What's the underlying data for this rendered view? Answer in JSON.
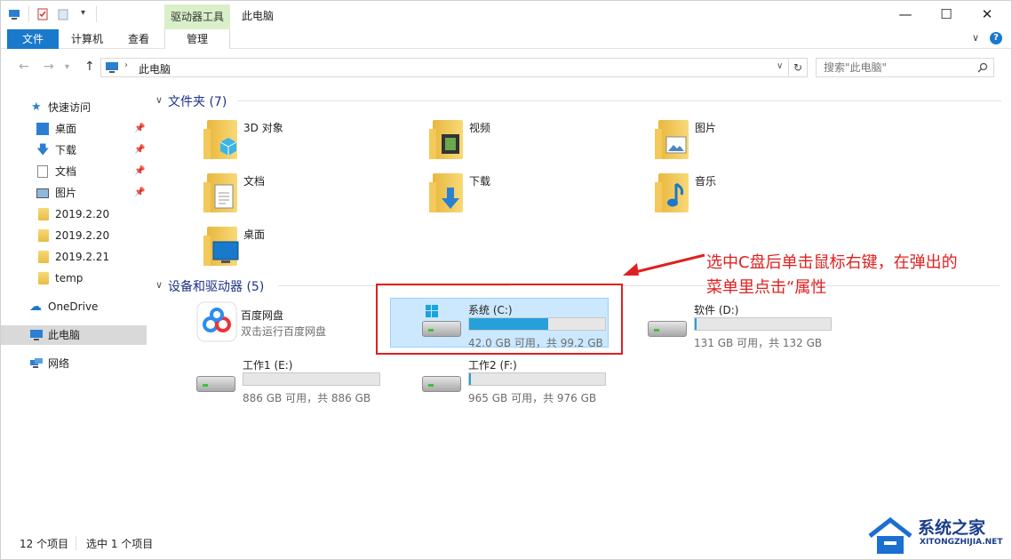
{
  "titlebar": {
    "context_tab": "驱动器工具",
    "window_title": "此电脑",
    "minimize": "—",
    "maximize": "☐",
    "close": "✕"
  },
  "ribbon": {
    "tabs": [
      "文件",
      "计算机",
      "查看",
      "管理"
    ],
    "help": "?",
    "expand": "∨"
  },
  "address": {
    "path": "此电脑",
    "search_placeholder": "搜索\"此电脑\"",
    "back": "←",
    "forward": "→",
    "up": "↑",
    "refresh": "↻",
    "dropdown": "∨"
  },
  "sidebar": {
    "quick_access": "快速访问",
    "items": [
      {
        "label": "桌面",
        "pinned": true
      },
      {
        "label": "下载",
        "pinned": true
      },
      {
        "label": "文档",
        "pinned": true
      },
      {
        "label": "图片",
        "pinned": true
      },
      {
        "label": "2019.2.20",
        "pinned": false
      },
      {
        "label": "2019.2.20",
        "pinned": false
      },
      {
        "label": "2019.2.21",
        "pinned": false
      },
      {
        "label": "temp",
        "pinned": false
      }
    ],
    "onedrive": "OneDrive",
    "this_pc": "此电脑",
    "network": "网络"
  },
  "folders": {
    "header": "文件夹 (7)",
    "items": [
      "3D 对象",
      "视频",
      "图片",
      "文档",
      "下载",
      "音乐",
      "桌面"
    ]
  },
  "drives": {
    "header": "设备和驱动器 (5)",
    "baidu": {
      "name": "百度网盘",
      "sub": "双击运行百度网盘"
    },
    "items": [
      {
        "name": "系统 (C:)",
        "sub": "42.0 GB 可用，共 99.2 GB",
        "used_fraction": 0.58
      },
      {
        "name": "软件 (D:)",
        "sub": "131 GB 可用，共 132 GB",
        "used_fraction": 0.01
      },
      {
        "name": "工作1 (E:)",
        "sub": "886 GB 可用，共 886 GB",
        "used_fraction": 0.0
      },
      {
        "name": "工作2 (F:)",
        "sub": "965 GB 可用，共 976 GB",
        "used_fraction": 0.01
      }
    ]
  },
  "status": {
    "count": "12 个项目",
    "selected": "选中 1 个项目"
  },
  "annotation": {
    "line1": "选中C盘后单击鼠标右键，在弹出的",
    "line2": "菜单里点击“属性"
  },
  "watermark": {
    "brand": "系统之家",
    "url": "XITONGZHIJIA.NET"
  },
  "colors": {
    "accent": "#1979ca",
    "selection": "#cce8ff",
    "annotation": "#e02020",
    "bar_fill": "#26a0da"
  }
}
